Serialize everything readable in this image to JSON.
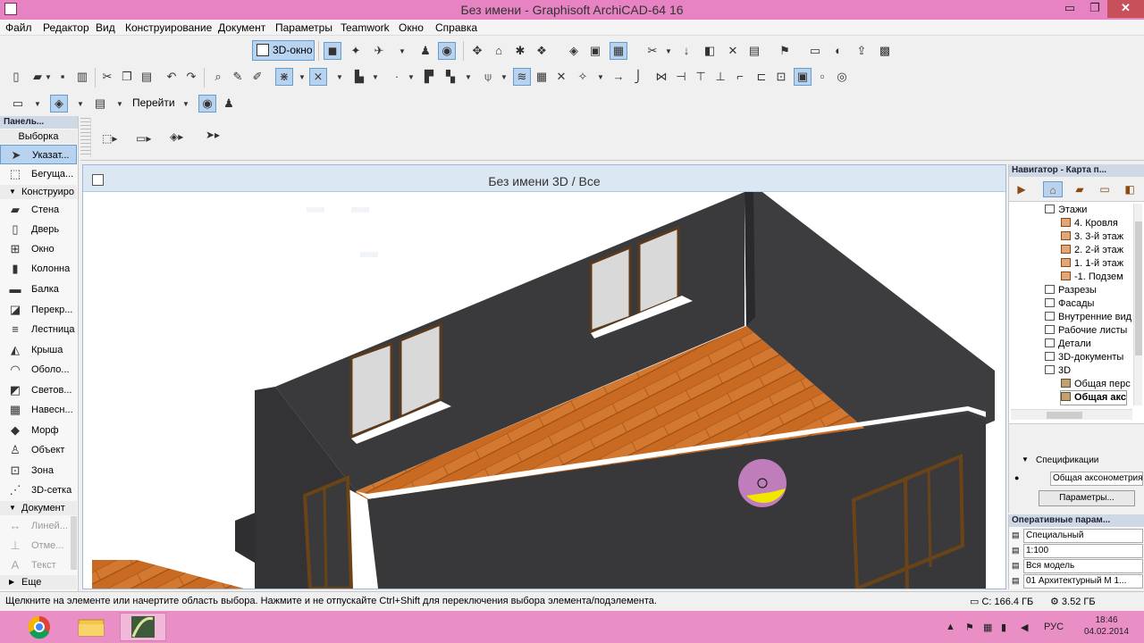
{
  "window": {
    "title": "Без имени - Graphisoft ArchiCAD-64 16",
    "min": "▭",
    "max": "❐",
    "close": "✕"
  },
  "menu": [
    "Файл",
    "Редактор",
    "Вид",
    "Конструирование",
    "Документ",
    "Параметры",
    "Teamwork",
    "Окно",
    "Справка"
  ],
  "toolbar": {
    "view3d_label": "3D-окно",
    "goto_label": "Перейти"
  },
  "toolbox": {
    "header": "Панель...",
    "selection_label": "Выборка",
    "tools_selection": [
      {
        "label": "Указат...",
        "icon": "arrow-pointer-icon"
      },
      {
        "label": "Бегуща...",
        "icon": "marquee-icon"
      }
    ],
    "group_construction": "Конструиро",
    "tools_construction": [
      {
        "label": "Стена",
        "icon": "wall-icon"
      },
      {
        "label": "Дверь",
        "icon": "door-icon"
      },
      {
        "label": "Окно",
        "icon": "window-icon"
      },
      {
        "label": "Колонна",
        "icon": "column-icon"
      },
      {
        "label": "Балка",
        "icon": "beam-icon"
      },
      {
        "label": "Перекр...",
        "icon": "slab-icon"
      },
      {
        "label": "Лестница",
        "icon": "stair-icon"
      },
      {
        "label": "Крыша",
        "icon": "roof-icon"
      },
      {
        "label": "Оболо...",
        "icon": "shell-icon"
      },
      {
        "label": "Светов...",
        "icon": "skylight-icon"
      },
      {
        "label": "Навесн...",
        "icon": "curtain-wall-icon"
      },
      {
        "label": "Морф",
        "icon": "morph-icon"
      },
      {
        "label": "Объект",
        "icon": "object-icon"
      },
      {
        "label": "Зона",
        "icon": "zone-icon"
      },
      {
        "label": "3D-сетка",
        "icon": "mesh-icon"
      }
    ],
    "group_document": "Документ",
    "tools_document": [
      {
        "label": "Линей...",
        "icon": "dimension-icon"
      },
      {
        "label": "Отме...",
        "icon": "level-icon"
      },
      {
        "label": "Текст",
        "icon": "text-icon"
      }
    ],
    "group_more": "Еще"
  },
  "view": {
    "title": "Без имени 3D / Все"
  },
  "navigator": {
    "header": "Навигатор - Карта п...",
    "tree": [
      {
        "label": "Этажи",
        "level": 1,
        "icon": "doc"
      },
      {
        "label": "4. Кровля",
        "level": 2,
        "icon": "folder"
      },
      {
        "label": "3. 3-й этаж",
        "level": 2,
        "icon": "folder"
      },
      {
        "label": "2. 2-й этаж",
        "level": 2,
        "icon": "folder"
      },
      {
        "label": "1. 1-й этаж",
        "level": 2,
        "icon": "folder"
      },
      {
        "label": "-1. Подзем",
        "level": 2,
        "icon": "folder"
      },
      {
        "label": "Разрезы",
        "level": 1,
        "icon": "doc"
      },
      {
        "label": "Фасады",
        "level": 1,
        "icon": "doc"
      },
      {
        "label": "Внутренние вид",
        "level": 1,
        "icon": "doc"
      },
      {
        "label": "Рабочие листы",
        "level": 1,
        "icon": "doc"
      },
      {
        "label": "Детали",
        "level": 1,
        "icon": "doc"
      },
      {
        "label": "3D-документы",
        "level": 1,
        "icon": "doc"
      },
      {
        "label": "3D",
        "level": 1,
        "icon": "doc"
      },
      {
        "label": "Общая перс",
        "level": 2,
        "icon": "cube"
      },
      {
        "label": "Общая акс",
        "level": 2,
        "icon": "cube",
        "selected": true
      }
    ]
  },
  "spec": {
    "label": "Спецификации",
    "field": "Общая аксонометрия",
    "button": "Параметры..."
  },
  "quick_options": {
    "header": "Оперативные парам...",
    "rows": [
      "Специальный",
      "1:100",
      "Вся модель",
      "01 Архитектурный М 1..."
    ]
  },
  "status": {
    "message": "Щелкните на элементе или начертите область выбора. Нажмите и не отпускайте Ctrl+Shift для переключения выбора элемента/подэлемента.",
    "disk": "С: 166.4 ГБ",
    "memory": "3.52 ГБ"
  },
  "taskbar": {
    "lang": "РУС",
    "time": "18:46",
    "date": "04.02.2014"
  },
  "colors": {
    "titlebar": "#e783c2",
    "taskbar": "#e98fc6",
    "selection": "#b8d3ef",
    "wall": "#3a3a3c",
    "floor": "#c86a22"
  }
}
